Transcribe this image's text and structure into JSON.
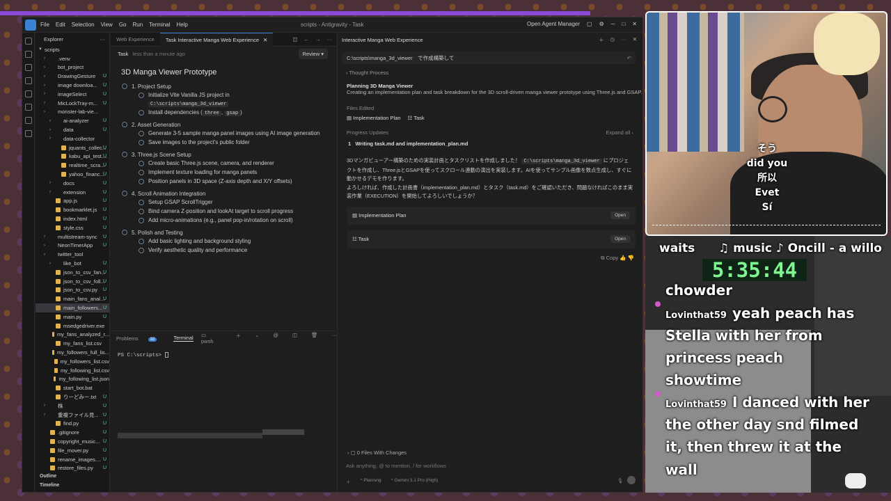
{
  "titlebar": {
    "menu": [
      "File",
      "Edit",
      "Selection",
      "View",
      "Go",
      "Run",
      "Terminal",
      "Help"
    ],
    "title": "scripts - Antigravity - Task",
    "agent_manager": "Open Agent Manager"
  },
  "explorer": {
    "header": "Explorer",
    "root": "scripts",
    "items": [
      {
        "label": ".venv",
        "type": "folder",
        "badge": ""
      },
      {
        "label": "bot_project",
        "type": "folder",
        "badge": ""
      },
      {
        "label": "DrawingGesture",
        "type": "folder",
        "badge": "U"
      },
      {
        "label": "image downloa...",
        "type": "folder",
        "badge": "U"
      },
      {
        "label": "imageSelect",
        "type": "folder",
        "badge": "U"
      },
      {
        "label": "MicLockTray-m...",
        "type": "folder",
        "badge": "U"
      },
      {
        "label": "monster-lab-vie...",
        "type": "folder",
        "badge": ""
      },
      {
        "label": "ai-analyzer",
        "type": "folder",
        "badge": "U"
      },
      {
        "label": "data",
        "type": "folder",
        "badge": "U"
      },
      {
        "label": "data-collector",
        "type": "folder",
        "badge": ""
      },
      {
        "label": "jquants_collec...",
        "type": "file",
        "badge": "U"
      },
      {
        "label": "kabu_api_test....",
        "type": "file",
        "badge": "U"
      },
      {
        "label": "realtime_scra...",
        "type": "file",
        "badge": "U"
      },
      {
        "label": "yahoo_financ...",
        "type": "file",
        "badge": "U"
      },
      {
        "label": "docs",
        "type": "folder",
        "badge": "U"
      },
      {
        "label": "extension",
        "type": "folder",
        "badge": "U"
      },
      {
        "label": "app.js",
        "type": "file",
        "badge": "U"
      },
      {
        "label": "bookmarklet.js",
        "type": "file",
        "badge": "U"
      },
      {
        "label": "index.html",
        "type": "file",
        "badge": "U"
      },
      {
        "label": "style.css",
        "type": "file",
        "badge": "U"
      },
      {
        "label": "multistream-sync",
        "type": "folder",
        "badge": "U"
      },
      {
        "label": "NeonTimerApp",
        "type": "folder",
        "badge": "U"
      },
      {
        "label": "twitter_tool",
        "type": "folder",
        "badge": ""
      },
      {
        "label": "like_bot",
        "type": "folder",
        "badge": "U"
      },
      {
        "label": "json_to_csv_fan...",
        "type": "file",
        "badge": "U"
      },
      {
        "label": "json_to_csv_foll...",
        "type": "file",
        "badge": "U"
      },
      {
        "label": "json_to_csv.py",
        "type": "file",
        "badge": "U"
      },
      {
        "label": "main_fans_anal...",
        "type": "file",
        "badge": "U"
      },
      {
        "label": "main_followers...",
        "type": "file",
        "badge": "U"
      },
      {
        "label": "main.py",
        "type": "file",
        "badge": "U"
      },
      {
        "label": "msedgedriver.exe",
        "type": "file",
        "badge": ""
      },
      {
        "label": "my_fans_analyzed_r...",
        "type": "file",
        "badge": ""
      },
      {
        "label": "my_fans_list.csv",
        "type": "file",
        "badge": ""
      },
      {
        "label": "my_followers_full_lis...",
        "type": "file",
        "badge": ""
      },
      {
        "label": "my_followers_list.csv",
        "type": "file",
        "badge": ""
      },
      {
        "label": "my_following_list.csv",
        "type": "file",
        "badge": ""
      },
      {
        "label": "my_following_list.json",
        "type": "file",
        "badge": ""
      },
      {
        "label": "start_bot.bat",
        "type": "file",
        "badge": ""
      },
      {
        "label": "りーどみー.txt",
        "type": "file",
        "badge": "U"
      },
      {
        "label": "株",
        "type": "folder",
        "badge": "U"
      },
      {
        "label": "重複ファイル見...",
        "type": "folder",
        "badge": "U"
      },
      {
        "label": "find.py",
        "type": "file",
        "badge": "U"
      },
      {
        "label": ".gitignore",
        "type": "file",
        "badge": "U"
      },
      {
        "label": "copyright_music...",
        "type": "file",
        "badge": "U"
      },
      {
        "label": "file_mover.py",
        "type": "file",
        "badge": "U"
      },
      {
        "label": "rename_images....",
        "type": "file",
        "badge": "U"
      },
      {
        "label": "restore_files.py",
        "type": "file",
        "badge": "U"
      }
    ],
    "outline": "Outline",
    "timeline": "Timeline"
  },
  "editor": {
    "tabs": [
      "Web Experience",
      "Task Interactive Manga Web Experience"
    ],
    "task_label": "Task",
    "ago": "less than a minute ago",
    "review": "Review",
    "heading": "3D Manga Viewer Prototype",
    "sections": [
      {
        "title": "1. Project Setup",
        "items": [
          "Initialize Vite Vanilla JS project in",
          "Install dependencies ("
        ]
      },
      {
        "title": "2. Asset Generation",
        "items": [
          "Generate 3-5 sample manga panel images using AI image generation",
          "Save images to the project's public folder"
        ]
      },
      {
        "title": "3. Three.js Scene Setup",
        "items": [
          "Create basic Three.js scene, camera, and renderer",
          "Implement texture loading for manga panels",
          "Position panels in 3D space (Z-axis depth and X/Y offsets)"
        ]
      },
      {
        "title": "4. Scroll Animation Integration",
        "items": [
          "Setup GSAP ScrollTrigger",
          "Bind camera Z-position and lookAt target to scroll progress",
          "Add micro-animations (e.g., panel pop-in/rotation on scroll)"
        ]
      },
      {
        "title": "5. Polish and Testing",
        "items": [
          "Add basic lighting and background styling",
          "Verify aesthetic quality and performance"
        ]
      }
    ],
    "code_path": "C:\\scripts\\manga_3d_viewer",
    "dep1": "three",
    "dep2": "gsap"
  },
  "panel": {
    "problems": "Problems",
    "problems_count": "32",
    "terminal": "Terminal",
    "shell": "pwsh",
    "prompt": "PS C:\\scripts> "
  },
  "agent": {
    "header": "Interactive Manga Web Experience",
    "command": "C:\\scripts\\manga_3d_viewer　で作成構築して",
    "thought": "Thought Process",
    "plan_title": "Planning 3D Manga Viewer",
    "plan_desc": "Creating an implementation plan and task breakdown for the 3D scroll-driven manga viewer prototype using Three.js and GSAP.",
    "files_edited": "Files Edited",
    "file1": "Implementation Plan",
    "file2": "Task",
    "progress": "Progress Updates",
    "expand": "Expand all",
    "writing": "Writing task.md and implementation_plan.md",
    "msg1": "3Dマンガビューアー構築のための実装計画とタスクリストを作成しました！",
    "msg_code": "C:\\scripts\\manga_3d_viewer",
    "msg2": "にプロジェクトを作成し、Three.jsとGSAPを使ってスクロール連動の演出を実装します。AIを使ってサンプル画像を数点生成し、すぐに動かせるデモを作ります。",
    "msg3": "よろしければ、作成した計画書（implementation_plan.md）とタスク（task.md）をご確認いただき、問題なければこのまま実装作業（EXECUTION）を開始してよろしいでしょうか？",
    "card1": "Implementation Plan",
    "card2": "Task",
    "open": "Open",
    "copy": "Copy",
    "files_changes": "0 Files With Changes",
    "input_placeholder": "Ask anything, @ to mention, / for workflows",
    "mode": "Planning",
    "model": "Gemini 3.1 Pro (High)"
  },
  "stream": {
    "subtitle": [
      "そう",
      "did you",
      "所以",
      "Evet",
      "Sí"
    ],
    "chat_top": "waits",
    "music": "♫ music ♪ Oncill - a willo",
    "timer": "5:35:44",
    "m1": "chowder",
    "u1": "Lovinthat59",
    "m2a": "yeah peach has",
    "m2b": "Stella with her from",
    "m2c": "princess peach",
    "m2d": "showtime",
    "u2": "Lovinthat59",
    "m3a": "I danced with her",
    "m3b": "the other day snd filmed",
    "m3c": "it, then threw it at the",
    "m3d": "wall"
  }
}
